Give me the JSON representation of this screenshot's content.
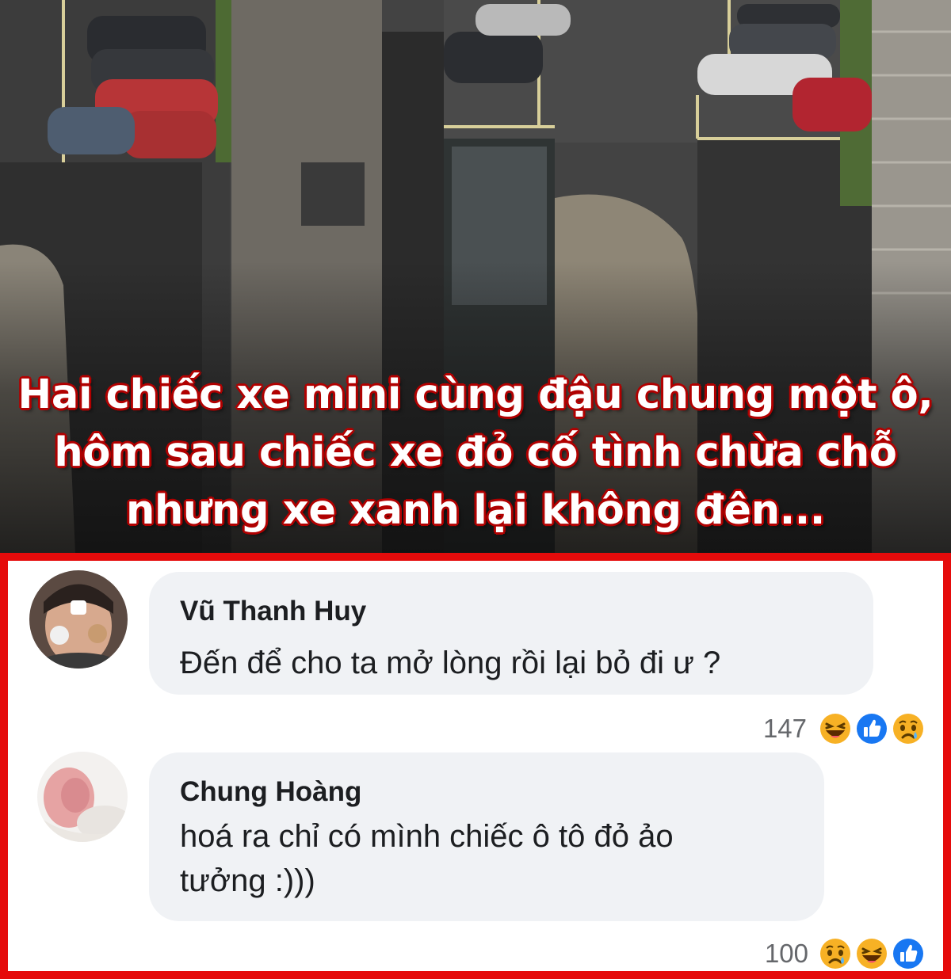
{
  "caption": {
    "lines": [
      "Hai chiếc xe mini cùng đậu chung một ô,",
      "hôm sau chiếc xe đỏ cố tình chừa chỗ",
      "nhưng xe xanh lại không đên..."
    ]
  },
  "comments": [
    {
      "author": "Vũ Thanh Huy",
      "text": "Đến để cho ta mở lòng rồi lại bỏ đi ư ?",
      "reaction_count": "147",
      "reactions": [
        "haha-icon",
        "like-icon",
        "sad-icon"
      ]
    },
    {
      "author": "Chung Hoàng",
      "text_lines": [
        "hoá ra chỉ có mình chiếc ô tô đỏ ảo",
        "tưởng :)))"
      ],
      "reaction_count": "100",
      "reactions": [
        "sad-icon",
        "haha-icon",
        "like-icon"
      ]
    }
  ],
  "colors": {
    "border": "#e50b0b",
    "bubble": "#f0f2f5",
    "caption_outline": "#b10000",
    "like": "#1877f2",
    "emoji": "#f7b125"
  }
}
